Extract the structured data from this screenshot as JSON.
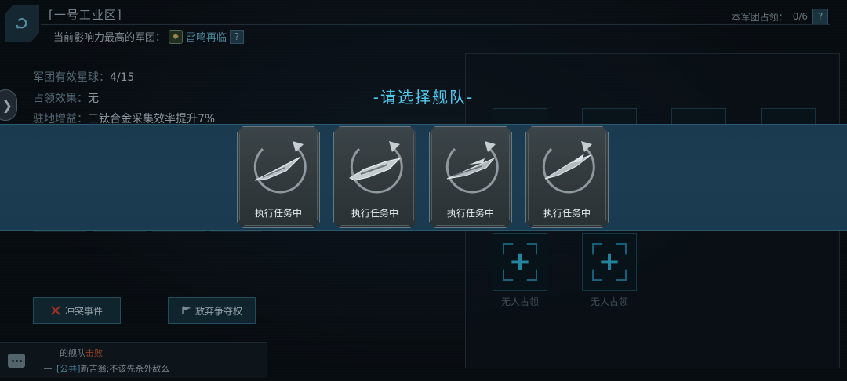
{
  "header": {
    "zone_title": "[一号工业区]",
    "influence_label": "当前影响力最高的军团：",
    "top_legion_name": "雷鸣再临",
    "help_label": "?",
    "occupy_label": "本军团占领：",
    "occupy_value": "0/6"
  },
  "info": {
    "planets_label": "军团有效星球：",
    "planets_value": "4/15",
    "effect_label": "占领效果：",
    "effect_value": "无",
    "bonus_label": "驻地增益：",
    "bonus_value": "三钛合金采集效率提升7%"
  },
  "slots": {
    "empty_label_1": "无人占领",
    "empty_label_2": "无人占领",
    "add_symbol": "+"
  },
  "buttons": {
    "conflict_label": "冲突事件",
    "abandon_label": "放弃争夺权"
  },
  "chat": {
    "line1_prefix": "的舰队",
    "line1_status": "击败",
    "channel": "[公共]",
    "message": "新吉翁:不该先杀外敌么"
  },
  "fleet_selector": {
    "title": "-请选择舰队-",
    "fleets": [
      {
        "status": "执行任务中",
        "ship_icon": "frigate-ship-icon"
      },
      {
        "status": "执行任务中",
        "ship_icon": "cruiser-ship-icon"
      },
      {
        "status": "执行任务中",
        "ship_icon": "destroyer-ship-icon"
      },
      {
        "status": "执行任务中",
        "ship_icon": "interceptor-ship-icon"
      }
    ]
  },
  "colors": {
    "accent": "#4ec9ec",
    "band": "#1c3c52",
    "alert": "#c9542e"
  }
}
